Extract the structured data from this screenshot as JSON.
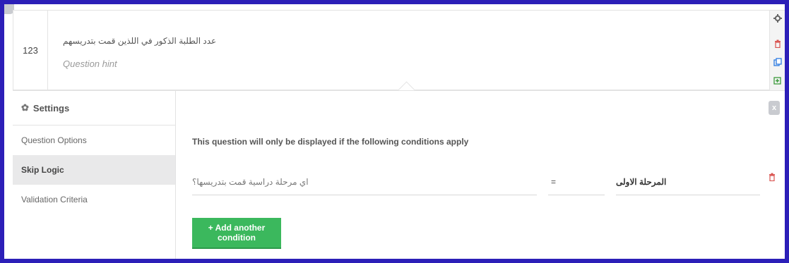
{
  "question": {
    "number": "123",
    "text": "عدد الطلبة الذكور في اللذين قمت بتدريسهم",
    "hint": "Question hint"
  },
  "actions": {
    "settings_icon": "gear-icon",
    "delete_icon": "trash-icon",
    "duplicate_icon": "copy-icon",
    "add_icon": "add-icon"
  },
  "settings": {
    "header": "Settings",
    "items": [
      {
        "label": "Question Options"
      },
      {
        "label": "Skip Logic"
      },
      {
        "label": "Validation Criteria"
      }
    ],
    "active_item": "Skip Logic"
  },
  "skip_logic": {
    "title": "This question will only be displayed if the following conditions apply",
    "condition": {
      "question": "اي مرحلة دراسية قمت بتدريسها؟",
      "operator": "=",
      "value": "المرحلة الاولى"
    },
    "add_button": "+ Add another condition",
    "close_label": "x"
  },
  "colors": {
    "frame": "#2c1fb8",
    "add_button": "#3bb85d",
    "danger": "#d9534f",
    "link": "#2a7ae2",
    "success_icon": "#3c9a3c"
  }
}
